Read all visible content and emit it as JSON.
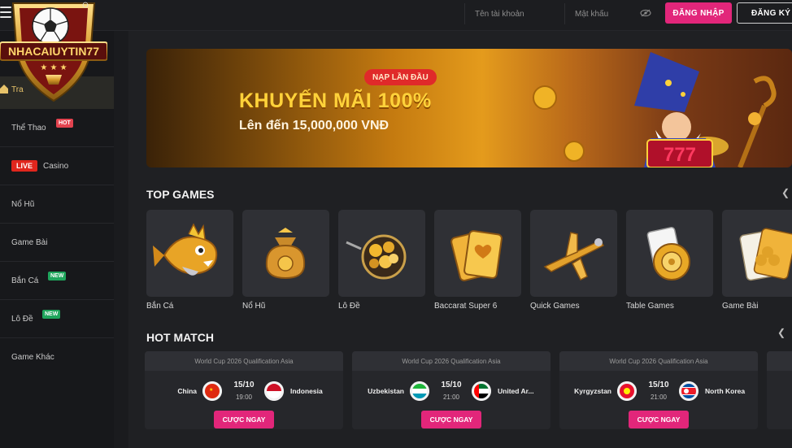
{
  "header": {
    "username_placeholder": "Tên tài khoản",
    "password_placeholder": "Mật khẩu",
    "login_label": "ĐĂNG NHẬP",
    "register_label": "ĐĂNG KÝ"
  },
  "logo": {
    "text": "NHACAIUYTIN77"
  },
  "sidebar": {
    "home_label": "Tra",
    "items": [
      {
        "label": "Thể Thao",
        "badge": "HOT"
      },
      {
        "label": "Casino",
        "live": "LIVE"
      },
      {
        "label": "Nổ Hũ"
      },
      {
        "label": "Game Bài"
      },
      {
        "label": "Bắn Cá",
        "badge": "NEW"
      },
      {
        "label": "Lô Đề",
        "badge": "NEW"
      },
      {
        "label": "Game Khác"
      }
    ]
  },
  "banner": {
    "tag": "NẠP LẦN ĐẦU",
    "title": "KHUYẾN MÃI 100%",
    "subtitle": "Lên đến 15,000,000 VNĐ",
    "slot_text": "777"
  },
  "top_games": {
    "title": "TOP GAMES",
    "items": [
      {
        "label": "Bắn Cá",
        "icon": "fish-icon"
      },
      {
        "label": "Nổ Hũ",
        "icon": "money-bag-icon"
      },
      {
        "label": "Lô Đề",
        "icon": "lottery-balls-icon"
      },
      {
        "label": "Baccarat Super 6",
        "icon": "cards-icon"
      },
      {
        "label": "Quick Games",
        "icon": "airplane-icon"
      },
      {
        "label": "Table Games",
        "icon": "chip-icon"
      },
      {
        "label": "Game Bài",
        "icon": "card-clubs-icon"
      }
    ]
  },
  "hot_match": {
    "title": "HOT MATCH",
    "bet_label": "CƯỢC NGAY",
    "matches": [
      {
        "league": "World Cup 2026 Qualification Asia",
        "home": "China",
        "away": "Indonesia",
        "date": "15/10",
        "time": "19:00"
      },
      {
        "league": "World Cup 2026 Qualification Asia",
        "home": "Uzbekistan",
        "away": "United Ar...",
        "date": "15/10",
        "time": "21:00"
      },
      {
        "league": "World Cup 2026 Qualification Asia",
        "home": "Kyrgyzstan",
        "away": "North Korea",
        "date": "15/10",
        "time": "21:00"
      }
    ]
  },
  "colors": {
    "accent": "#e2267a",
    "background": "#1f2023",
    "banner_gold": "#ffd23a"
  }
}
